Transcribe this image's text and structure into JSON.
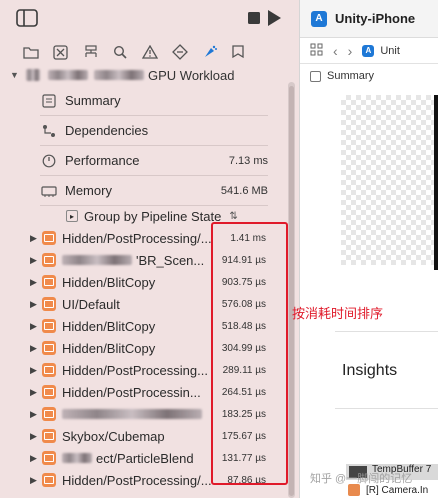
{
  "toolbar": {
    "sidebar_icon": "sidebar-toggle-icon",
    "stop_icon": "stop-icon",
    "run_icon": "play-icon"
  },
  "navigator": {
    "icons": [
      "folder-icon",
      "source-control-icon",
      "hierarchy-icon",
      "search-icon",
      "warning-icon",
      "test-diamond-icon",
      "debug-spray-icon",
      "tag-icon"
    ],
    "workload_title": "GPU Workload",
    "sections": [
      {
        "label": "Summary",
        "value": "",
        "icon": "summary-icon"
      },
      {
        "label": "Dependencies",
        "value": "",
        "icon": "dependencies-icon"
      },
      {
        "label": "Performance",
        "value": "7.13 ms",
        "icon": "gauge-icon"
      },
      {
        "label": "Memory",
        "value": "541.6 MB",
        "icon": "memory-icon"
      }
    ],
    "group_by": "Group by Pipeline State",
    "rows": [
      {
        "label": "Hidden/PostProcessing/...",
        "value": "1.41 ms"
      },
      {
        "label": "'BR_Scen...",
        "value": "914.91 µs"
      },
      {
        "label": "Hidden/BlitCopy",
        "value": "903.75 µs"
      },
      {
        "label": "UI/Default",
        "value": "576.08 µs"
      },
      {
        "label": "Hidden/BlitCopy",
        "value": "518.48 µs"
      },
      {
        "label": "Hidden/BlitCopy",
        "value": "304.99 µs"
      },
      {
        "label": "Hidden/PostProcessing...",
        "value": "289.11 µs"
      },
      {
        "label": "Hidden/PostProcessin...",
        "value": "264.51 µs"
      },
      {
        "label": "",
        "value": "183.25 µs"
      },
      {
        "label": "Skybox/Cubemap",
        "value": "175.67 µs"
      },
      {
        "label": "ect/ParticleBlend",
        "value": "131.77 µs"
      },
      {
        "label": "Hidden/PostProcessing/...",
        "value": "87.86 µs"
      }
    ],
    "annotation": "按消耗时间排序"
  },
  "editor": {
    "tab_title": "Unity-iPhone",
    "jump_text": "Unit",
    "summary_label": "Summary",
    "insights_label": "Insights",
    "bottom_item_1": "TempBuffer 7",
    "bottom_item_2": "[R] Camera.In"
  },
  "watermark": "知乎 @一脚闯的记忆",
  "colors": {
    "highlight": "#e01a2a",
    "sidebar_bg": "#f1e1e1",
    "row_icon": "#f08a4b",
    "app_icon": "#1e78d6"
  }
}
